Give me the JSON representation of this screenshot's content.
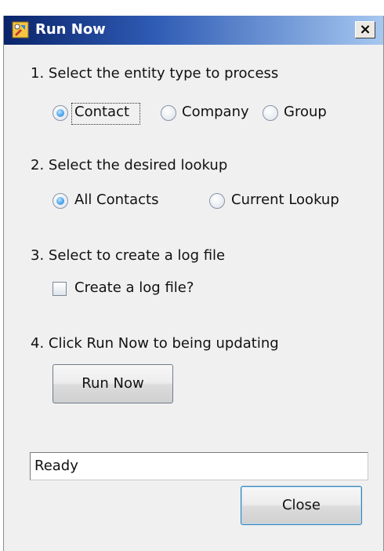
{
  "window": {
    "title": "Run Now",
    "close_glyph": "×",
    "icon": "app-tools-icon"
  },
  "step1": {
    "label": "1. Select the entity type to process",
    "options": [
      "Contact",
      "Company",
      "Group"
    ],
    "selected": "Contact"
  },
  "step2": {
    "label": "2. Select the desired lookup",
    "options": [
      "All Contacts",
      "Current Lookup"
    ],
    "selected": "All Contacts"
  },
  "step3": {
    "label": "3. Select to create a log file",
    "checkbox_label": "Create a log file?",
    "checked": false
  },
  "step4": {
    "label": "4. Click Run Now to being updating",
    "run_button": "Run Now"
  },
  "status": {
    "text": "Ready"
  },
  "footer": {
    "close_button": "Close"
  },
  "colors": {
    "title_start": "#0a246a",
    "title_end": "#a6c8f0",
    "radio_selected": "#4aa3e8"
  }
}
